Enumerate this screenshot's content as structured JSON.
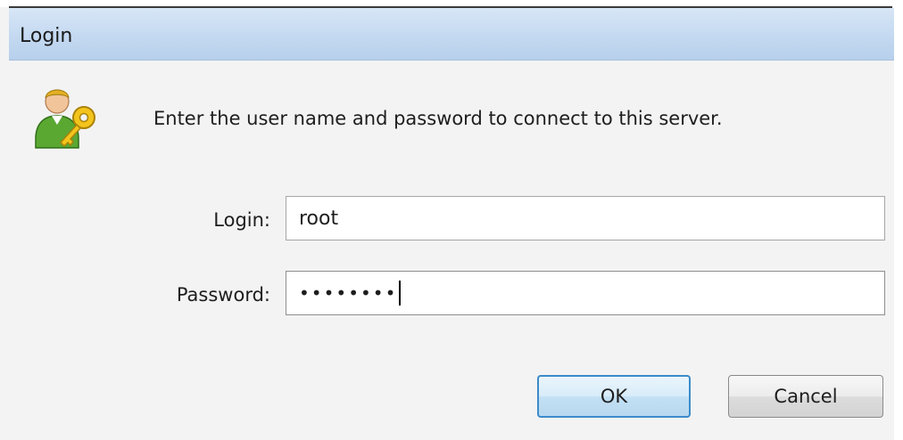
{
  "window": {
    "title": "Login"
  },
  "message": "Enter the user name and password to connect to this server.",
  "form": {
    "login_label": "Login:",
    "login_value": "root",
    "password_label": "Password:",
    "password_masked": "••••••••"
  },
  "buttons": {
    "ok_label": "OK",
    "cancel_label": "Cancel"
  },
  "icons": {
    "dialog_icon": "user-key-icon"
  },
  "colors": {
    "title_bar": "#c4d9f1",
    "ok_border": "#3c8bc9",
    "background": "#f3f3f3"
  }
}
